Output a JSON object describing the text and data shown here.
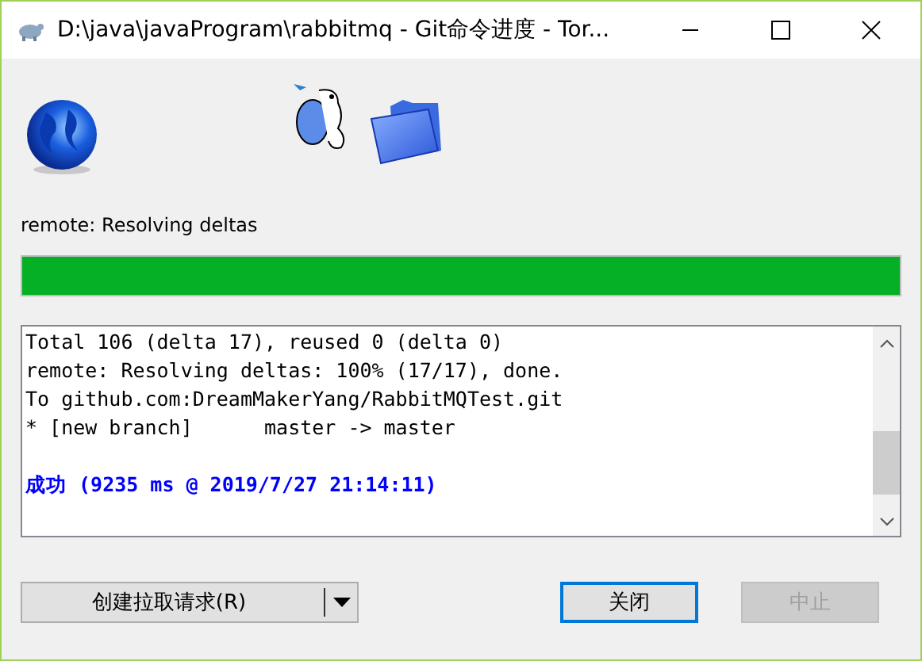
{
  "window": {
    "title": "D:\\java\\javaProgram\\rabbitmq - Git命令进度 - Tor..."
  },
  "status": "remote: Resolving deltas",
  "progress": {
    "level": 1
  },
  "log": [
    {
      "kind": "normal",
      "text": "Total 106 (delta 17), reused 0 (delta 0)"
    },
    {
      "kind": "normal",
      "text": "remote: Resolving deltas: 100% (17/17), done."
    },
    {
      "kind": "normal",
      "text": "To github.com:DreamMakerYang/RabbitMQTest.git"
    },
    {
      "kind": "normal",
      "text": "* [new branch]      master -> master"
    },
    {
      "kind": "blank"
    },
    {
      "kind": "success",
      "text": "成功 (9235 ms @ 2019/7/27 21:14:11)"
    }
  ],
  "buttons": [
    {
      "kind": "split",
      "label": "创建拉取请求(R)"
    },
    {
      "kind": "plain",
      "label": "关闭",
      "default": true,
      "disabled": false
    },
    {
      "kind": "plain",
      "label": "中止",
      "default": false,
      "disabled": true
    }
  ]
}
